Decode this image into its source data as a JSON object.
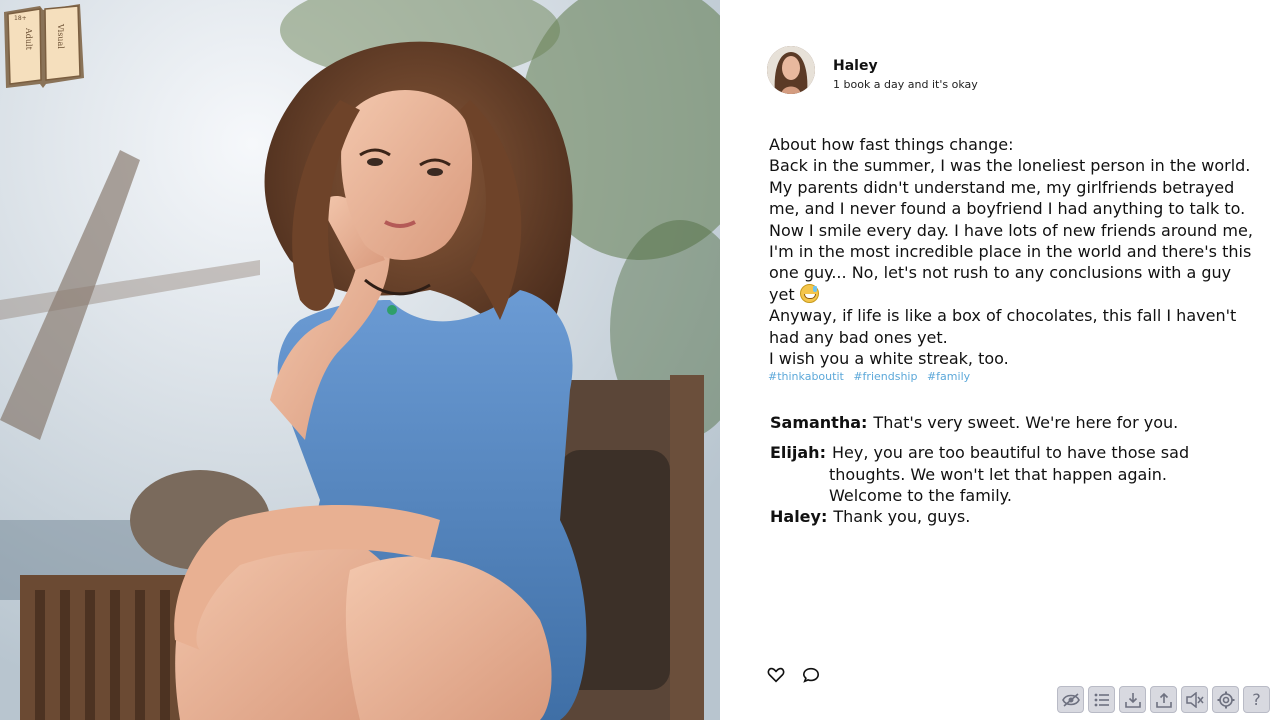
{
  "logo": {
    "text_top": "18+",
    "text_left": "Adult",
    "text_right": "Visual"
  },
  "post": {
    "author": "Haley",
    "status": "1 book a day and it's okay",
    "body": "About how fast things change:\nBack in the summer, I was the loneliest person in the world.\nMy parents didn't understand me, my girlfriends betrayed me, and I never found a boyfriend I had anything to talk to.\nNow I smile every day. I have lots of new friends around me, I'm in the most incredible place in the world and there's this one guy... No, let's not rush to any conclusions with a guy yet",
    "body_end": "\nAnyway, if life is like a box of chocolates, this fall I haven't had any bad ones yet.\nI wish you a white streak, too.",
    "tags": [
      "#thinkaboutit",
      "#friendship",
      "#family"
    ]
  },
  "comments": [
    {
      "author": "Samantha:",
      "text": "That's very sweet. We're here for you."
    },
    {
      "author": "Elijah:",
      "text": "Hey, you are too beautiful to have those sad",
      "cont": "thoughts. We won't let that happen again.\nWelcome to the family."
    },
    {
      "author": "Haley:",
      "text": "Thank you, guys."
    }
  ],
  "icons": {
    "like": "heart-icon",
    "comment": "comment-icon",
    "toolbar": [
      "hide-icon",
      "history-icon",
      "save-icon",
      "load-icon",
      "mute-icon",
      "settings-icon",
      "help-icon"
    ]
  },
  "toolbar_help_glyph": "?"
}
